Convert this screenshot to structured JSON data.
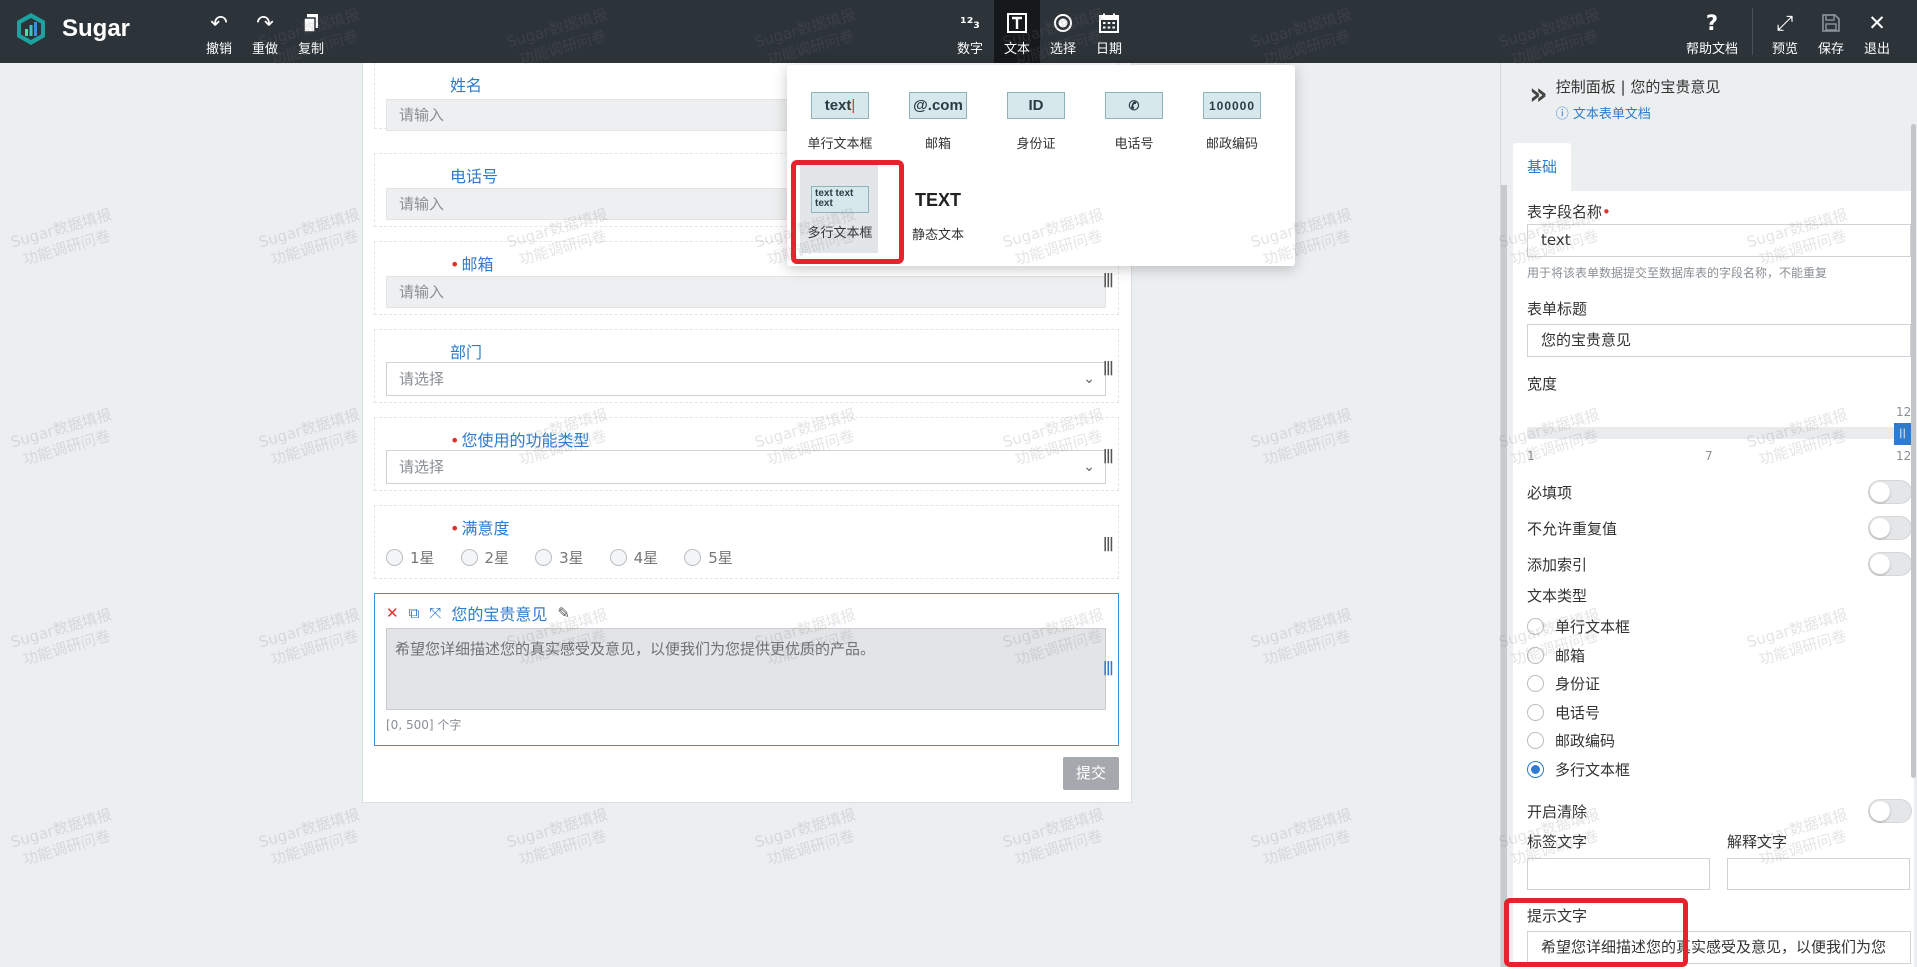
{
  "app": {
    "name": "Sugar"
  },
  "toolbar": {
    "undo": "撤销",
    "redo": "重做",
    "copy": "复制",
    "number": "数字",
    "text": "文本",
    "choice": "选择",
    "date": "日期",
    "help": "帮助文档",
    "preview": "预览",
    "save": "保存",
    "exit": "退出"
  },
  "watermark": {
    "line1": "Sugar数据填报",
    "line2": "功能调研问卷"
  },
  "form": {
    "fields": [
      {
        "label": "姓名",
        "required": false,
        "placeholder": "请输入"
      },
      {
        "label": "电话号",
        "required": false,
        "placeholder": "请输入"
      },
      {
        "label": "邮箱",
        "required": true,
        "placeholder": "请输入"
      },
      {
        "label": "部门",
        "required": false,
        "placeholder": "请选择"
      },
      {
        "label": "您使用的功能类型",
        "required": true,
        "placeholder": "请选择"
      },
      {
        "label": "满意度",
        "required": true,
        "options": [
          "1星",
          "2星",
          "3星",
          "4星",
          "5星"
        ]
      }
    ],
    "active_field": {
      "label": "您的宝贵意见",
      "placeholder": "希望您详细描述您的真实感受及意见，以便我们为您提供更优质的产品。",
      "count_hint": "[0, 500] 个字"
    },
    "submit": "提交"
  },
  "text_menu": {
    "items": [
      {
        "icon_text": "text",
        "label": "单行文本框"
      },
      {
        "icon_text": "@.com",
        "label": "邮箱"
      },
      {
        "icon_text": "ID",
        "label": "身份证"
      },
      {
        "icon_text": "phone-icon",
        "label": "电话号"
      },
      {
        "icon_text": "100000",
        "label": "邮政编码"
      },
      {
        "icon_text": "text text text",
        "label": "多行文本框"
      },
      {
        "icon_text": "TEXT",
        "label": "静态文本"
      }
    ],
    "selected": "多行文本框"
  },
  "panel": {
    "title": "控制面板 | 您的宝贵意见",
    "doc_link": "文本表单文档",
    "tab": "基础",
    "field_name_label": "表字段名称",
    "field_name_value": "text",
    "field_name_help": "用于将该表单数据提交至数据库表的字段名称，不能重复",
    "form_title_label": "表单标题",
    "form_title_value": "您的宝贵意见",
    "width_label": "宽度",
    "width": {
      "min": "1",
      "mid": "7",
      "max": "12",
      "value": "12"
    },
    "toggles": [
      {
        "label": "必填项",
        "on": false
      },
      {
        "label": "不允许重复值",
        "on": false
      },
      {
        "label": "添加索引",
        "on": false
      }
    ],
    "text_type_label": "文本类型",
    "text_types": [
      {
        "label": "单行文本框",
        "checked": false
      },
      {
        "label": "邮箱",
        "checked": false
      },
      {
        "label": "身份证",
        "checked": false
      },
      {
        "label": "电话号",
        "checked": false
      },
      {
        "label": "邮政编码",
        "checked": false
      },
      {
        "label": "多行文本框",
        "checked": true
      }
    ],
    "clear_label": "开启清除",
    "tag_text_label": "标签文字",
    "explain_text_label": "解释文字",
    "hint_label": "提示文字",
    "hint_value": "希望您详细描述您的真实感受及意见，以便我们为您"
  },
  "colors": {
    "accent": "#2e7bcf",
    "highlight": "#e8222d",
    "topbar": "#2c3339"
  }
}
